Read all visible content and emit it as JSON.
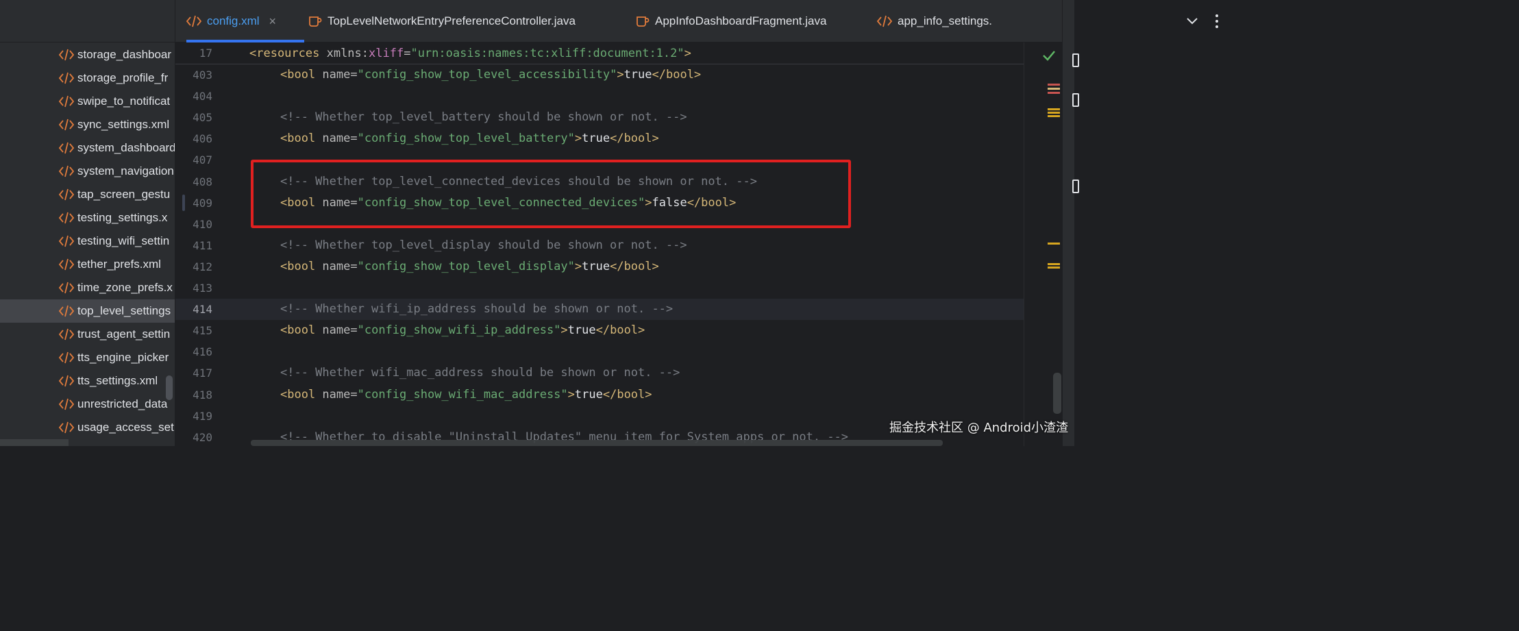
{
  "sidebar": {
    "items": [
      {
        "label": "storage_dashboar",
        "icon": "xml-file-icon"
      },
      {
        "label": "storage_profile_fr",
        "icon": "xml-file-icon"
      },
      {
        "label": "swipe_to_notificat",
        "icon": "xml-file-icon"
      },
      {
        "label": "sync_settings.xml",
        "icon": "xml-file-icon"
      },
      {
        "label": "system_dashboard",
        "icon": "xml-file-icon"
      },
      {
        "label": "system_navigation",
        "icon": "xml-file-icon"
      },
      {
        "label": "tap_screen_gestu",
        "icon": "xml-file-icon"
      },
      {
        "label": "testing_settings.x",
        "icon": "xml-file-icon"
      },
      {
        "label": "testing_wifi_settin",
        "icon": "xml-file-icon"
      },
      {
        "label": "tether_prefs.xml",
        "icon": "xml-file-icon"
      },
      {
        "label": "time_zone_prefs.x",
        "icon": "xml-file-icon"
      },
      {
        "label": "top_level_settings",
        "icon": "xml-file-icon",
        "selected": true
      },
      {
        "label": "trust_agent_settin",
        "icon": "xml-file-icon"
      },
      {
        "label": "tts_engine_picker",
        "icon": "xml-file-icon"
      },
      {
        "label": "tts_settings.xml",
        "icon": "xml-file-icon"
      },
      {
        "label": "unrestricted_data",
        "icon": "xml-file-icon"
      },
      {
        "label": "usage_access_set",
        "icon": "xml-file-icon"
      }
    ]
  },
  "tabs": [
    {
      "label": "config.xml",
      "icon": "xml-file-icon",
      "active": true,
      "close": "×"
    },
    {
      "label": "TopLevelNetworkEntryPreferenceController.java",
      "icon": "java-class-icon"
    },
    {
      "label": "AppInfoDashboardFragment.java",
      "icon": "java-class-icon"
    },
    {
      "label": "app_info_settings.",
      "icon": "xml-file-icon"
    }
  ],
  "editor": {
    "sticky": {
      "line_no": "17",
      "parts": [
        {
          "t": "tag",
          "v": "<resources "
        },
        {
          "t": "attr",
          "v": "xmlns:"
        },
        {
          "t": "ns",
          "v": "xliff"
        },
        {
          "t": "attr",
          "v": "="
        },
        {
          "t": "val",
          "v": "\"urn:oasis:names:tc:xliff:document:1.2\""
        },
        {
          "t": "tag",
          "v": ">"
        }
      ]
    },
    "lines": [
      {
        "no": "403",
        "parts": [
          {
            "t": "tag",
            "v": "<bool "
          },
          {
            "t": "attr",
            "v": "name="
          },
          {
            "t": "val",
            "v": "\"config_show_top_level_accessibility\""
          },
          {
            "t": "tag",
            "v": ">"
          },
          {
            "t": "text",
            "v": "true"
          },
          {
            "t": "tag",
            "v": "</bool>"
          }
        ]
      },
      {
        "no": "404",
        "parts": []
      },
      {
        "no": "405",
        "parts": [
          {
            "t": "comment",
            "v": "<!-- Whether top_level_battery should be shown or not. -->"
          }
        ]
      },
      {
        "no": "406",
        "parts": [
          {
            "t": "tag",
            "v": "<bool "
          },
          {
            "t": "attr",
            "v": "name="
          },
          {
            "t": "val",
            "v": "\"config_show_top_level_battery\""
          },
          {
            "t": "tag",
            "v": ">"
          },
          {
            "t": "text",
            "v": "true"
          },
          {
            "t": "tag",
            "v": "</bool>"
          }
        ]
      },
      {
        "no": "407",
        "parts": []
      },
      {
        "no": "408",
        "parts": [
          {
            "t": "comment",
            "v": "<!-- Whether top_level_connected_devices should be shown or not. -->"
          }
        ]
      },
      {
        "no": "409",
        "parts": [
          {
            "t": "tag",
            "v": "<bool "
          },
          {
            "t": "attr",
            "v": "name="
          },
          {
            "t": "val",
            "v": "\"config_show_top_level_connected_devices\""
          },
          {
            "t": "tag",
            "v": ">"
          },
          {
            "t": "text",
            "v": "false"
          },
          {
            "t": "tag",
            "v": "</bool>"
          }
        ]
      },
      {
        "no": "410",
        "parts": []
      },
      {
        "no": "411",
        "parts": [
          {
            "t": "comment",
            "v": "<!-- Whether top_level_display should be shown or not. -->"
          }
        ]
      },
      {
        "no": "412",
        "parts": [
          {
            "t": "tag",
            "v": "<bool "
          },
          {
            "t": "attr",
            "v": "name="
          },
          {
            "t": "val",
            "v": "\"config_show_top_level_display\""
          },
          {
            "t": "tag",
            "v": ">"
          },
          {
            "t": "text",
            "v": "true"
          },
          {
            "t": "tag",
            "v": "</bool>"
          }
        ]
      },
      {
        "no": "413",
        "parts": []
      },
      {
        "no": "414",
        "current": true,
        "parts": [
          {
            "t": "comment",
            "v": "<!-- Whether wifi_ip_address should be shown or not. -->"
          }
        ]
      },
      {
        "no": "415",
        "parts": [
          {
            "t": "tag",
            "v": "<bool "
          },
          {
            "t": "attr",
            "v": "name="
          },
          {
            "t": "val",
            "v": "\"config_show_wifi_ip_address\""
          },
          {
            "t": "tag",
            "v": ">"
          },
          {
            "t": "text",
            "v": "true"
          },
          {
            "t": "tag",
            "v": "</bool>"
          }
        ]
      },
      {
        "no": "416",
        "parts": []
      },
      {
        "no": "417",
        "parts": [
          {
            "t": "comment",
            "v": "<!-- Whether wifi_mac_address should be shown or not. -->"
          }
        ]
      },
      {
        "no": "418",
        "parts": [
          {
            "t": "tag",
            "v": "<bool "
          },
          {
            "t": "attr",
            "v": "name="
          },
          {
            "t": "val",
            "v": "\"config_show_wifi_mac_address\""
          },
          {
            "t": "tag",
            "v": ">"
          },
          {
            "t": "text",
            "v": "true"
          },
          {
            "t": "tag",
            "v": "</bool>"
          }
        ]
      },
      {
        "no": "419",
        "parts": []
      },
      {
        "no": "420",
        "parts": [
          {
            "t": "comment",
            "v": "<!-- Whether to disable \"Uninstall Updates\" menu item for System apps or not. -->"
          }
        ]
      }
    ]
  },
  "watermark": "掘金技术社区 @ Android小渣渣",
  "colors": {
    "tag": "#d5b778",
    "attr": "#bababa",
    "value": "#6aab73",
    "namespace": "#c77dbb",
    "comment": "#7a7e85",
    "highlight_border": "#e02020",
    "active_tab": "#4b9ef0"
  }
}
